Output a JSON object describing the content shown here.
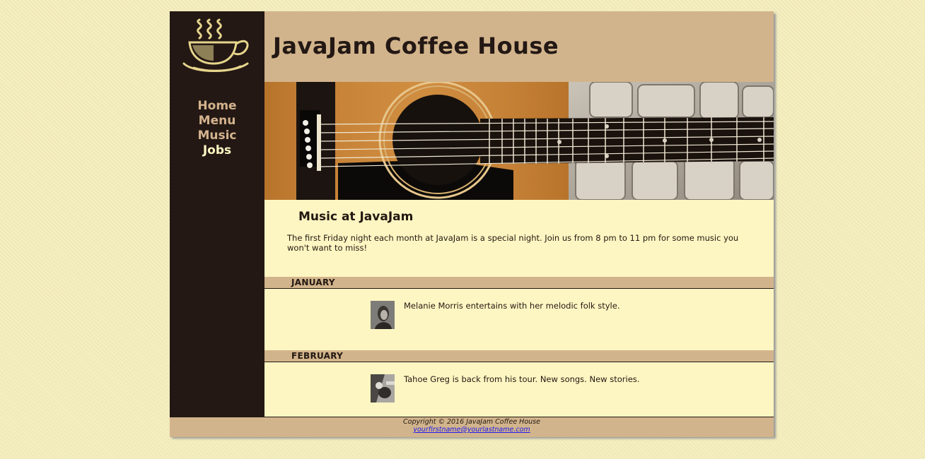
{
  "site": {
    "title": "JavaJam Coffee House"
  },
  "nav": {
    "items": [
      {
        "label": "Home"
      },
      {
        "label": "Menu"
      },
      {
        "label": "Music"
      },
      {
        "label": "Jobs"
      }
    ],
    "current": "Jobs"
  },
  "icons": {
    "logo": "coffee-cup-logo-icon",
    "hero": "acoustic-guitar-image"
  },
  "main": {
    "heading": "Music at JavaJam",
    "intro": "The first Friday night each month at JavaJam is a special night. Join us from 8 pm to 11 pm for some music you won't want to miss!",
    "events": [
      {
        "month": "JANUARY",
        "text": "Melanie Morris entertains with her melodic folk style."
      },
      {
        "month": "FEBRUARY",
        "text": "Tahoe Greg is back from his tour. New songs. New stories."
      }
    ]
  },
  "footer": {
    "copyright": "Copyright © 2016 JavaJam Coffee House",
    "email": "yourfirstname@yourlastname.com"
  },
  "colors": {
    "page_bg": "#f4eec0",
    "sidebar_bg": "#231814",
    "header_bg": "#d2b48c",
    "content_bg": "#fef6c2",
    "nav_link": "#d4b38e",
    "nav_current": "#fef6c2"
  }
}
